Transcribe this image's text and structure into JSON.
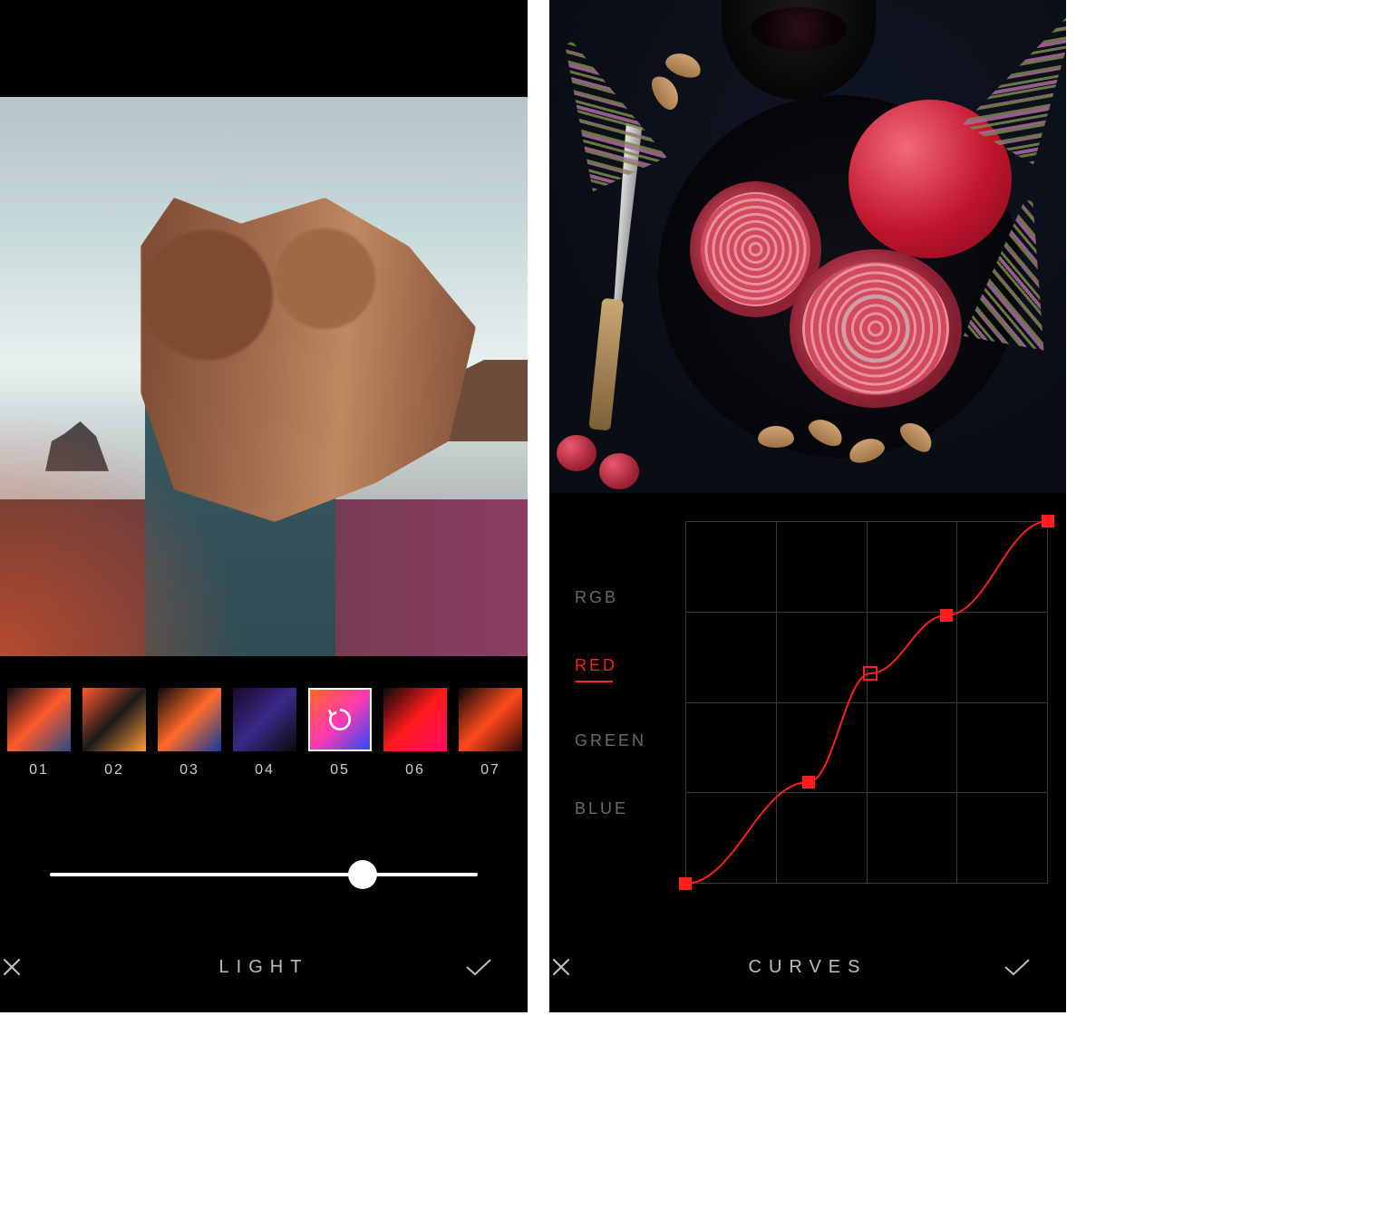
{
  "left": {
    "tool_label": "LIGHT",
    "slider_value": 73,
    "selected_filter": "05",
    "filters": [
      {
        "id": "01",
        "label": "01",
        "colors": [
          "#0a0c14",
          "#ff5a2a",
          "#2a4a8a"
        ]
      },
      {
        "id": "02",
        "label": "02",
        "colors": [
          "#ff5a2a",
          "#1a1a1a",
          "#ff9a3a"
        ]
      },
      {
        "id": "03",
        "label": "03",
        "colors": [
          "#0a0a0a",
          "#ff6a2a",
          "#103a9a"
        ]
      },
      {
        "id": "04",
        "label": "04",
        "colors": [
          "#1a0a2a",
          "#3a2a8a",
          "#0a0a0a"
        ]
      },
      {
        "id": "05",
        "label": "05",
        "colors": [
          "#ff6a1a",
          "#ff3ab0",
          "#1a4aff"
        ]
      },
      {
        "id": "06",
        "label": "06",
        "colors": [
          "#0a0a0a",
          "#ff1a1a",
          "#ff0a6a"
        ]
      },
      {
        "id": "07",
        "label": "07",
        "colors": [
          "#0a0a0a",
          "#ff4a1a",
          "#2a0a0a"
        ]
      }
    ]
  },
  "right": {
    "tool_label": "CURVES",
    "channels": [
      {
        "id": "rgb",
        "label": "RGB",
        "active": false
      },
      {
        "id": "red",
        "label": "RED",
        "active": true
      },
      {
        "id": "green",
        "label": "GREEN",
        "active": false
      },
      {
        "id": "blue",
        "label": "BLUE",
        "active": false
      }
    ],
    "curve_color": "#ff1f1f",
    "curve_points": [
      {
        "x": 0.0,
        "y": 0.0,
        "open": false
      },
      {
        "x": 0.34,
        "y": 0.28,
        "open": false
      },
      {
        "x": 0.51,
        "y": 0.58,
        "open": true
      },
      {
        "x": 0.72,
        "y": 0.74,
        "open": false
      },
      {
        "x": 1.0,
        "y": 1.0,
        "open": false
      }
    ]
  }
}
